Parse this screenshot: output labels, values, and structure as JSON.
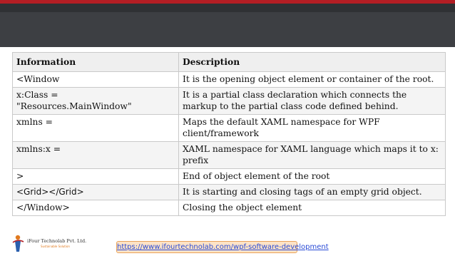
{
  "table": {
    "headers": [
      "Information",
      "Description"
    ],
    "rows": [
      {
        "info": "<Window",
        "desc": "It is the opening object element or container of the root."
      },
      {
        "info": "x:Class = \"Resources.MainWindow\"",
        "desc": "It is a partial class declaration which connects the markup to the partial class code defined behind."
      },
      {
        "info": "xmlns =",
        "desc": "Maps the default XAML namespace for WPF client/framework"
      },
      {
        "info": "xmlns:x =",
        "desc": "XAML namespace for XAML language which maps it to x: prefix"
      },
      {
        "info": ">",
        "desc": "End of object element of the root"
      },
      {
        "info": "<Grid></Grid>",
        "desc": "It is starting and closing tags of an empty grid object."
      },
      {
        "info": "</Window>",
        "desc": "Closing the object element"
      }
    ]
  },
  "footer": {
    "logo_name": "iFour Technolab Pvt. Ltd.",
    "logo_tagline": "Sustainable Solution",
    "link": "https://www.ifourtechnolab.com/wpf-software-development"
  },
  "colors": {
    "top_bar": "#3d3f43",
    "accent_red": "#b31e24",
    "link_bg": "#fde3c7"
  }
}
